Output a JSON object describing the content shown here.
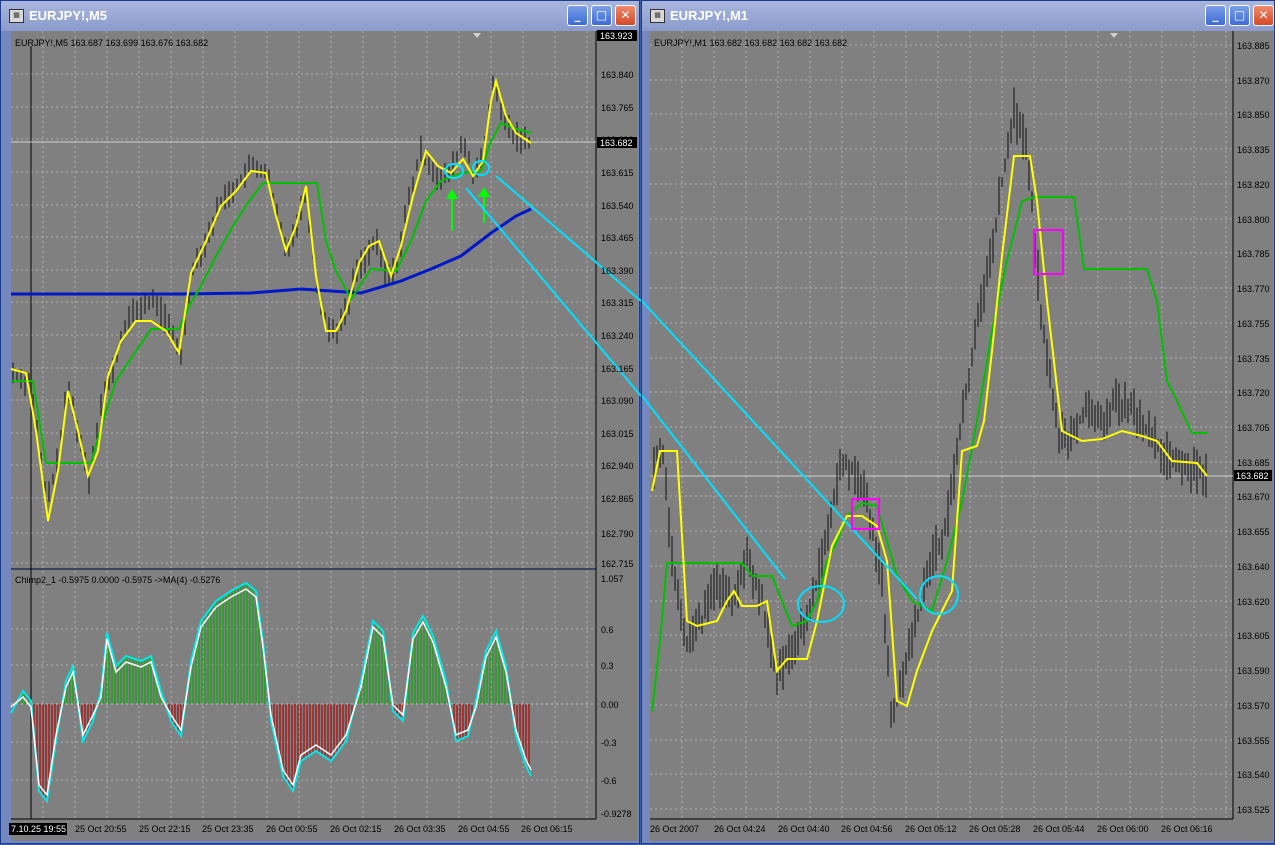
{
  "windows": [
    {
      "title": "EURJPY!,M5",
      "icon_name": "chart-window-icon",
      "buttons": [
        "minimize-icon",
        "maximize-icon",
        "close-icon"
      ]
    },
    {
      "title": "EURJPY!,M1",
      "icon_name": "chart-window-icon",
      "buttons": [
        "minimize-icon",
        "maximize-icon",
        "close-icon"
      ]
    }
  ],
  "m5": {
    "info": "EURJPY!,M5  163.687 163.699 163.676 163.682",
    "price_ticks": [
      "163.840",
      "163.765",
      "163.690",
      "163.615",
      "163.540",
      "163.465",
      "163.390",
      "163.315",
      "163.240",
      "163.165",
      "163.090",
      "163.015",
      "162.940",
      "162.865",
      "162.790",
      "162.715"
    ],
    "top_price": "163.923",
    "current_price": "163.682",
    "osc_info": "Chimp2_1 -0.5975 0.0000 -0.5975  ->MA(4) -0.5276",
    "osc_ticks": [
      "1.057",
      "0.6",
      "0.3",
      "0.00",
      "-0.3",
      "-0.6",
      "-0.9278"
    ],
    "time_cursor": "7.10.25 19:55",
    "time_ticks": [
      "25 Oct 20:55",
      "25 Oct 22:15",
      "25 Oct 23:35",
      "26 Oct 00:55",
      "26 Oct 02:15",
      "26 Oct 03:35",
      "26 Oct 04:55",
      "26 Oct 06:15"
    ],
    "colors": {
      "fast_ma": "#ffff00",
      "slow_ma": "#00c000",
      "long_ma": "#0018c8",
      "osc_line": "#00e8e8",
      "signal_line": "#ffffff",
      "hist_pos": "#22a022",
      "hist_neg": "#a02020",
      "annotation": "#00e0ff",
      "arrow": "#00ff00"
    }
  },
  "m1": {
    "info": "EURJPY!,M1  163.682 163.682 163.682 163.682",
    "price_ticks": [
      "163.885",
      "163.870",
      "163.850",
      "163.835",
      "163.820",
      "163.800",
      "163.785",
      "163.770",
      "163.755",
      "163.735",
      "163.720",
      "163.705",
      "163.685",
      "163.670",
      "163.655",
      "163.640",
      "163.620",
      "163.605",
      "163.590",
      "163.570",
      "163.555",
      "163.540",
      "163.525"
    ],
    "current_price": "163.682",
    "time_ticks": [
      "26 Oct 2007",
      "26 Oct 04:24",
      "26 Oct 04:40",
      "26 Oct 04:56",
      "26 Oct 05:12",
      "26 Oct 05:28",
      "26 Oct 05:44",
      "26 Oct 06:00",
      "26 Oct 06:16"
    ],
    "colors": {
      "fast_ma": "#ffff00",
      "slow_ma": "#00c000",
      "annotation": "#00e0ff",
      "box": "#ff00ff"
    }
  }
}
